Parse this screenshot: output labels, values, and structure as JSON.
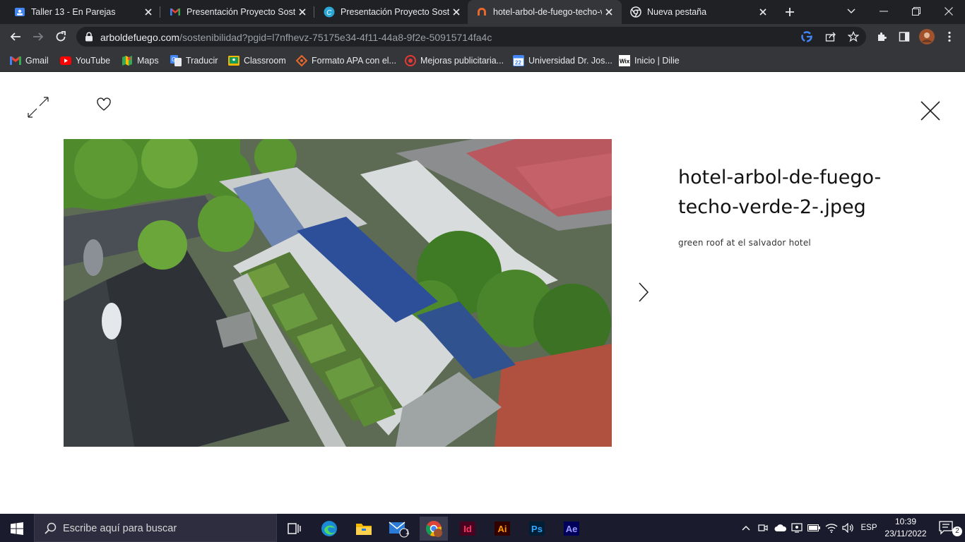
{
  "tabs": [
    {
      "title": "Taller 13 - En Parejas",
      "favicon": "google-classroom-icon"
    },
    {
      "title": "Presentación Proyecto Sostenible",
      "favicon": "gmail-icon"
    },
    {
      "title": "Presentación Proyecto Sostenible",
      "favicon": "canva-icon"
    },
    {
      "title": "hotel-arbol-de-fuego-techo-verde",
      "favicon": "arbol-de-fuego-icon",
      "active": true
    },
    {
      "title": "Nueva pestaña",
      "favicon": "chrome-icon"
    }
  ],
  "address": {
    "host": "arboldefuego.com",
    "path": "/sostenibilidad?pgid=l7nfhevz-75175e34-4f11-44a8-9f2e-50915714fa4c"
  },
  "bookmarks": [
    {
      "label": "Gmail",
      "icon": "gmail-icon"
    },
    {
      "label": "YouTube",
      "icon": "youtube-icon"
    },
    {
      "label": "Maps",
      "icon": "maps-icon"
    },
    {
      "label": "Traducir",
      "icon": "translate-icon"
    },
    {
      "label": "Classroom",
      "icon": "classroom-icon"
    },
    {
      "label": "Formato APA con el...",
      "icon": "apa-icon"
    },
    {
      "label": "Mejoras publicitaria...",
      "icon": "target-icon"
    },
    {
      "label": "Universidad Dr. Jos...",
      "icon": "calendar-icon"
    },
    {
      "label": "Inicio | Dilie",
      "icon": "wix-icon"
    }
  ],
  "lightbox": {
    "title": "hotel-arbol-de-fuego-techo-verde-2-.jpeg",
    "description": "green roof at el salvador hotel"
  },
  "taskbar": {
    "search_placeholder": "Escribe aquí para buscar",
    "mail_badge": "1",
    "language": "ESP",
    "time": "10:39",
    "date": "23/11/2022",
    "notifications": "2"
  },
  "colors": {
    "chrome_dark": "#202124",
    "chrome_toolbar": "#35363a",
    "taskbar": "#1b1b2e",
    "indesign": "#ff3366",
    "illustrator": "#ff9a00",
    "photoshop": "#31a8ff",
    "aftereffects": "#9999ff"
  }
}
